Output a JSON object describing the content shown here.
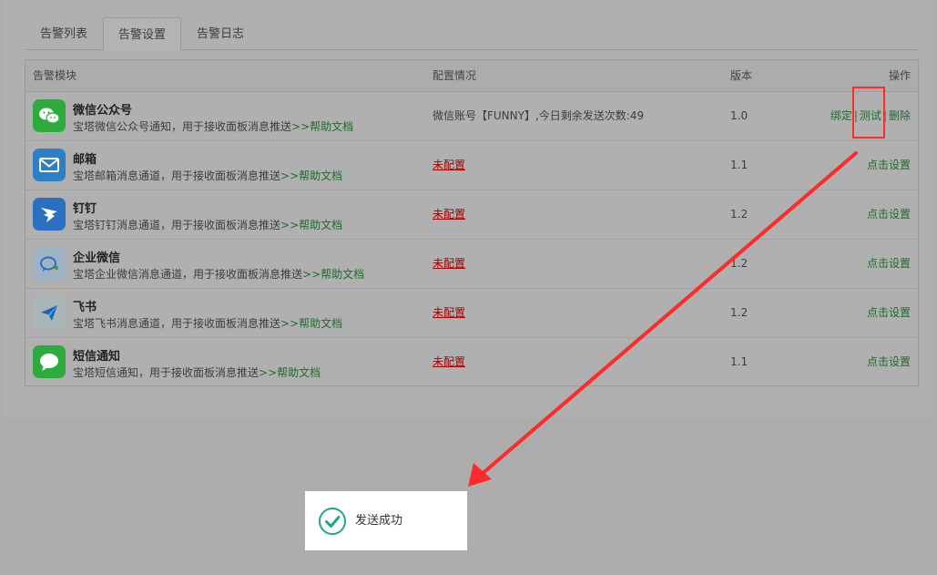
{
  "tabs": [
    {
      "label": "告警列表",
      "active": false
    },
    {
      "label": "告警设置",
      "active": true
    },
    {
      "label": "告警日志",
      "active": false
    }
  ],
  "table": {
    "headers": {
      "module": "告警模块",
      "config": "配置情况",
      "version": "版本",
      "actions": "操作"
    },
    "rows": [
      {
        "name": "微信公众号",
        "desc": "宝塔微信公众号通知，用于接收面板消息推送",
        "help": ">>帮助文档",
        "config": "微信账号【FUNNY】,今日剩余发送次数:49",
        "configured": true,
        "version": "1.0",
        "actions": [
          "绑定",
          "测试",
          "删除"
        ],
        "icon": "wechat-icon",
        "icon_color": "#2eab3f"
      },
      {
        "name": "邮箱",
        "desc": "宝塔邮箱消息通道，用于接收面板消息推送",
        "help": ">>帮助文档",
        "config": "未配置",
        "configured": false,
        "version": "1.1",
        "action": "点击设置",
        "icon": "mail-icon",
        "icon_color": "#2f7fc6"
      },
      {
        "name": "钉钉",
        "desc": "宝塔钉钉消息通道，用于接收面板消息推送",
        "help": ">>帮助文档",
        "config": "未配置",
        "configured": false,
        "version": "1.2",
        "action": "点击设置",
        "icon": "dingtalk-icon",
        "icon_color": "#2a6fc0"
      },
      {
        "name": "企业微信",
        "desc": "宝塔企业微信消息通道，用于接收面板消息推送",
        "help": ">>帮助文档",
        "config": "未配置",
        "configured": false,
        "version": "1.2",
        "action": "点击设置",
        "icon": "wecom-icon",
        "icon_color": "#9fb3c6"
      },
      {
        "name": "飞书",
        "desc": "宝塔飞书消息通道，用于接收面板消息推送",
        "help": ">>帮助文档",
        "config": "未配置",
        "configured": false,
        "version": "1.2",
        "action": "点击设置",
        "icon": "feishu-icon",
        "icon_color": "#a9b6b8"
      },
      {
        "name": "短信通知",
        "desc": "宝塔短信通知，用于接收面板消息推送",
        "help": ">>帮助文档",
        "config": "未配置",
        "configured": false,
        "version": "1.1",
        "action": "点击设置",
        "icon": "sms-icon",
        "icon_color": "#2eab3f"
      }
    ]
  },
  "toast": {
    "message": "发送成功",
    "icon": "check-circle-icon",
    "icon_color": "#20a58a"
  },
  "annotation_color": "#ff2a2a"
}
